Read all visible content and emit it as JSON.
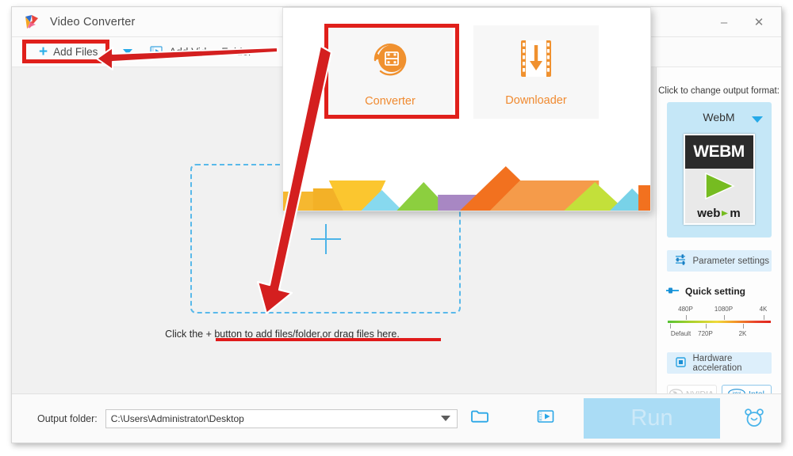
{
  "window": {
    "title": "Video Converter",
    "logo_icon": "app-logo-icon",
    "minimize_label": "–",
    "close_label": "✕"
  },
  "toolbar": {
    "add_files_label": "Add Files",
    "add_files_plus": "+",
    "add_files_caret_icon": "chevron-down-icon",
    "add_folder_label": "Add Video Folder",
    "add_folder_icon": "folder-video-icon",
    "trash_icon": "trash-icon"
  },
  "main": {
    "drop_hint": "Click the + button to add files/folder,or drag files here.",
    "drop_plus_icon": "plus-icon"
  },
  "sidebar": {
    "format_prompt": "Click to change output format:",
    "format_name": "WebM",
    "format_caret_icon": "chevron-down-icon",
    "thumb_top_text": "WEBM",
    "thumb_bottom_left": "web",
    "thumb_bottom_right": "m",
    "parameter_settings_label": "Parameter settings",
    "parameter_settings_icon": "sliders-icon",
    "quick_setting_label": "Quick setting",
    "quick_setting_icon": "slider-handle-icon",
    "slider_labels_top": [
      "480P",
      "1080P",
      "4K"
    ],
    "slider_labels_bottom": [
      "Default",
      "720P",
      "2K"
    ],
    "hardware_accel_label": "Hardware acceleration",
    "hardware_accel_icon": "chip-icon",
    "accel_options": [
      {
        "label": "NVIDIA",
        "icon": "nvidia-icon",
        "state": "disabled"
      },
      {
        "label": "Intel",
        "icon": "intel-icon",
        "state": "active"
      }
    ]
  },
  "bottom": {
    "output_folder_label": "Output folder:",
    "output_folder_value": "C:\\Users\\Administrator\\Desktop",
    "path_caret_icon": "chevron-down-icon",
    "browse_folder_icon": "folder-open-icon",
    "media_info_icon": "film-strip-icon",
    "run_label": "Run",
    "alarm_icon": "alarm-clock-icon"
  },
  "popup": {
    "tiles": [
      {
        "label": "Converter",
        "icon": "converter-circle-icon"
      },
      {
        "label": "Downloader",
        "icon": "download-filmstrip-icon"
      }
    ]
  },
  "colors": {
    "accent_blue": "#25a9e8",
    "orange": "#f08a30",
    "annotation_red": "#e0201b",
    "sidebar_card": "#c5e7f7",
    "run_button": "#aadcf5"
  }
}
